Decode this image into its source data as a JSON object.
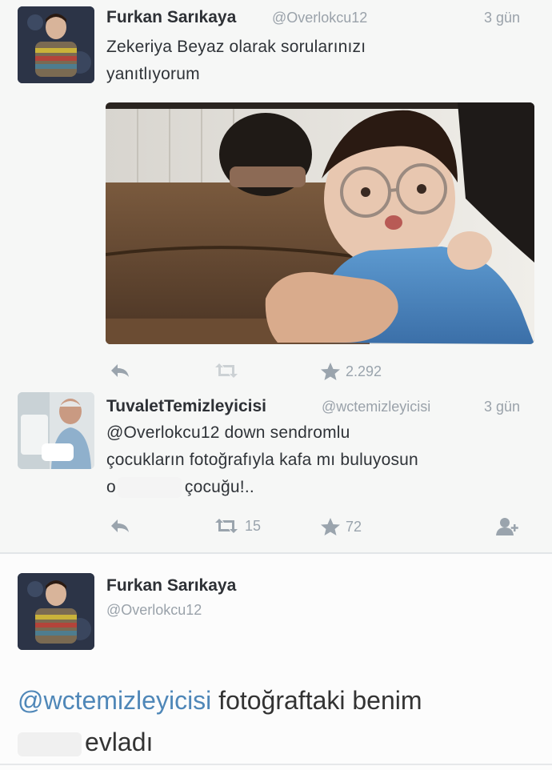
{
  "tweets": [
    {
      "name": "Furkan Sarıkaya",
      "handle": "@Overlokcu12",
      "time": "3 gün",
      "text_lines": [
        "Zekeriya Beyaz olarak sorularınızı",
        "yanıtlıyorum"
      ],
      "actions": {
        "retweets": "",
        "favorites": "2.292"
      }
    },
    {
      "name": "TuvaletTemizleyicisi",
      "handle": "@wctemizleyicisi",
      "time": "3 gün",
      "text_lines": [
        "@Overlokcu12 down sendromlu",
        "çocukların fotoğrafıyla kafa mı buluyosun",
        "çocuğu!.."
      ],
      "redacted_prefix": "o",
      "actions": {
        "retweets": "15",
        "favorites": "72"
      }
    }
  ],
  "reply": {
    "name": "Furkan Sarıkaya",
    "handle": "@Overlokcu12",
    "mention": "@wctemizleyicisi",
    "line1_rest": " fotoğraftaki benim",
    "line2_rest": "evladı"
  },
  "icons": {
    "reply": "reply-arrow-icon",
    "retweet": "retweet-icon",
    "favorite": "star-icon",
    "follow": "add-user-icon"
  },
  "colors": {
    "mention": "#4f87b8",
    "muted": "#9aa4ad",
    "text": "#2f3338"
  }
}
